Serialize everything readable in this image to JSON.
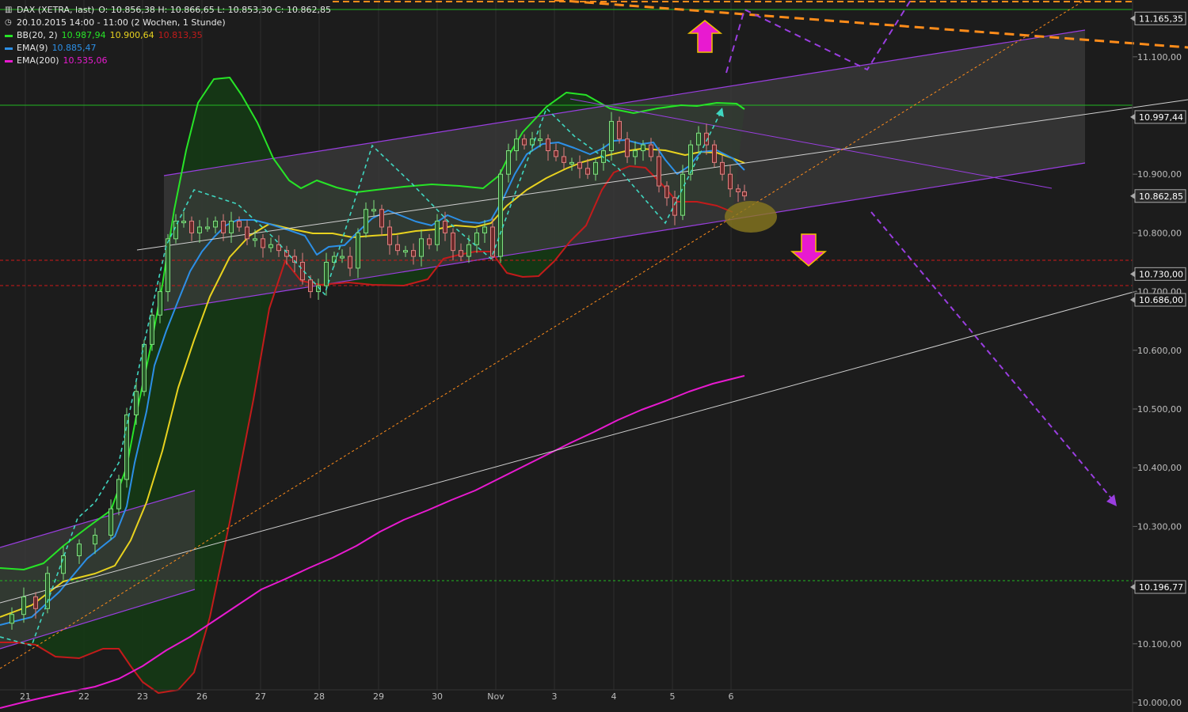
{
  "header": {
    "symbol": "DAX (XETRA, last)",
    "ohlc": "O: 10.856,38   H: 10.866,65   L: 10.853,30   C: 10.862,85",
    "period": "20.10.2015 14:00 - 11:00 (2 Wochen, 1 Stunde)"
  },
  "legend": [
    {
      "label": "BB(20, 2)",
      "color": "#27e427",
      "values": [
        {
          "text": "10.987,94",
          "color": "#27e427"
        },
        {
          "text": "10.900,64",
          "color": "#e8d21f"
        },
        {
          "text": "10.813,35",
          "color": "#c21b1b"
        }
      ]
    },
    {
      "label": "EMA(9)",
      "color": "#2c8fe6",
      "values": [
        {
          "text": "10.885,47",
          "color": "#2c8fe6"
        }
      ]
    },
    {
      "label": "EMA(200)",
      "color": "#e81ad0",
      "values": [
        {
          "text": "10.535,06",
          "color": "#e81ad0"
        }
      ]
    }
  ],
  "colors": {
    "background": "#1c1c1c",
    "grid": "#2e2e2e",
    "bb_upper": "#27e427",
    "bb_mid": "#e8d21f",
    "bb_lower": "#c21b1b",
    "ema9": "#2c8fe6",
    "ema200": "#e81ad0",
    "candle_up": "#7fe07f",
    "candle_down": "#e08080",
    "channel": "#9a3ee0",
    "zigzag": "#3fd6c0",
    "resistance": "#ff8c1a",
    "level_green": "#22b822",
    "level_red": "#d01818",
    "arrow": "#e81ad0"
  },
  "icons": {
    "arrow_up": "arrow-up-icon",
    "arrow_down": "arrow-down-icon",
    "chart": "chart-icon",
    "clock": "clock-icon"
  },
  "chart_data": {
    "type": "candlestick",
    "grid": true,
    "ylim": [
      10000,
      11200
    ],
    "y_ticks": [
      "10.000,00",
      "10.100,00",
      "10.200,00",
      "10.300,00",
      "10.400,00",
      "10.500,00",
      "10.600,00",
      "10.700,00",
      "10.800,00",
      "10.900,00",
      "11.100,00"
    ],
    "x_ticks": [
      "21",
      "22",
      "23",
      "26",
      "27",
      "28",
      "29",
      "30",
      "Nov",
      "3",
      "4",
      "5",
      "6"
    ],
    "price_labels": [
      {
        "text": "11.165,35",
        "value": 11165.35,
        "style": "line-green"
      },
      {
        "text": "10.997,44",
        "value": 10997.44,
        "style": "line-green"
      },
      {
        "text": "10.862,85",
        "value": 10862.85,
        "style": "current"
      },
      {
        "text": "10.730,00",
        "value": 10730.0,
        "style": "line-red"
      },
      {
        "text": "10.686,00",
        "value": 10686.0,
        "style": "line-red"
      },
      {
        "text": "10.196,77",
        "value": 10196.77,
        "style": "line-green-dashed"
      }
    ],
    "series": [
      {
        "name": "BB(20, 2)",
        "last": 10987.94
      },
      {
        "name": "BB(20, 2) mid",
        "last": 10900.64
      },
      {
        "name": "BB(20, 2) lower",
        "last": 10813.35
      },
      {
        "name": "EMA(9)",
        "last": 10885.47
      },
      {
        "name": "EMA(200)",
        "last": 10535.06
      }
    ]
  }
}
